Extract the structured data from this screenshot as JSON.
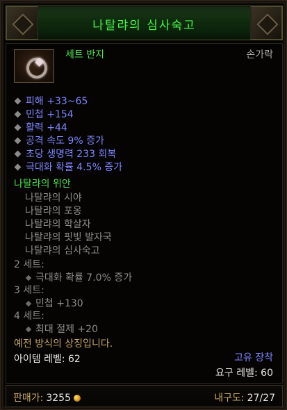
{
  "title": "나탈랴의 심사숙고",
  "item_type": "세트 반지",
  "slot": "손가락",
  "icon": "ring-icon",
  "colors": {
    "set_green": "#4fe04f",
    "affix_blue": "#7e86ff",
    "flavor_gold": "#c7a867",
    "inactive_grey": "#8c8c8c"
  },
  "affixes": [
    "피해 +33~65",
    "민첩 +154",
    "활력 +44",
    "공격 속도 9% 증가",
    "초당 생명력 233 회복",
    "극대화 확률 4.5% 증가"
  ],
  "set": {
    "name": "나탈랴의 위안",
    "items": [
      "나탈랴의 시야",
      "나탈랴의 포옹",
      "나탈랴의 학살자",
      "나탈랴의 핏빛 발자국",
      "나탈랴의 심사숙고"
    ],
    "bonuses": [
      {
        "title": "2 세트:",
        "effect": "극대화 확률 7.0% 증가"
      },
      {
        "title": "3 세트:",
        "effect": "민첩 +130"
      },
      {
        "title": "4 세트:",
        "effect": "최대 절제 +20"
      }
    ]
  },
  "flavor": "예전 방식의 상징입니다.",
  "item_level": "아이템 레벨: 62",
  "rarity": "고유 장착",
  "required_level": "요구 레벨: 60",
  "footer": {
    "sell_label": "판매가:",
    "sell_value": "3255",
    "durability_label": "내구도:",
    "durability_value": "27/27"
  }
}
